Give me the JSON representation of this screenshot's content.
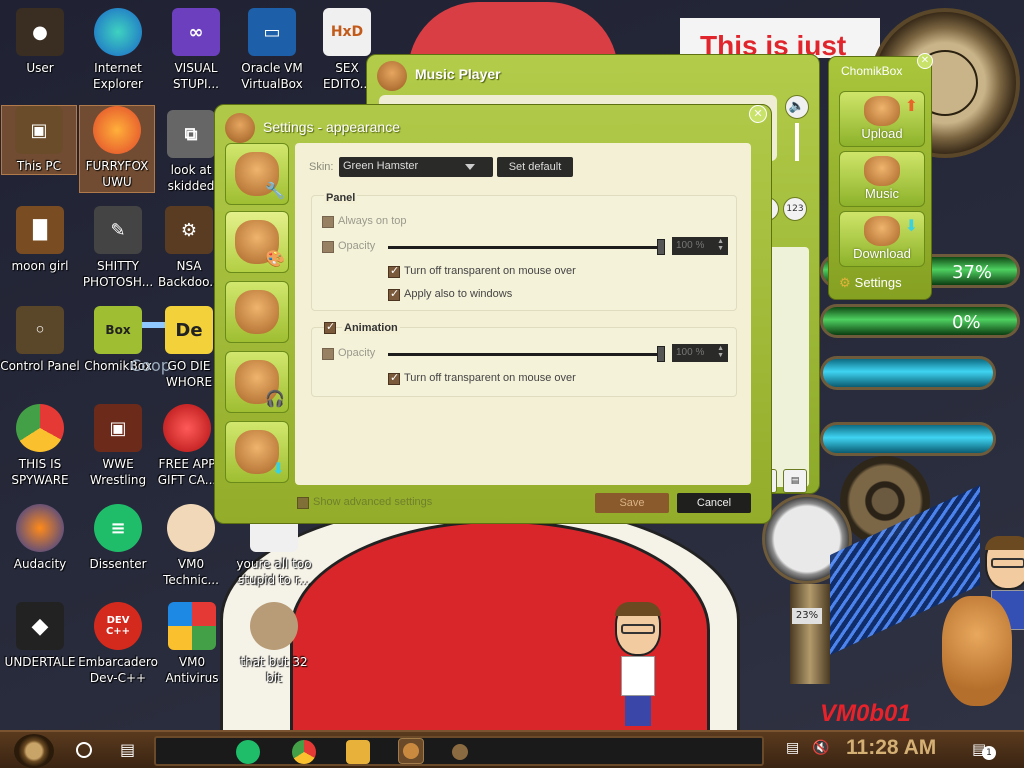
{
  "wallpaper": {
    "banner_text": "This is just",
    "signature": "VM0b01",
    "gauge_percent": "23%"
  },
  "desktop_icons": [
    {
      "id": "user",
      "label": "User",
      "icon": "user-folder-icon"
    },
    {
      "id": "ie",
      "label": "Internet Explorer",
      "icon": "edge-icon"
    },
    {
      "id": "vs",
      "label": "VISUAL STUPI...",
      "icon": "visual-studio-icon"
    },
    {
      "id": "vbox",
      "label": "Oracle VM VirtualBox",
      "icon": "virtualbox-icon"
    },
    {
      "id": "sex",
      "label": "SEX EDITO...",
      "icon": "hxd-icon"
    },
    {
      "id": "thispc",
      "label": "This PC",
      "icon": "computer-icon"
    },
    {
      "id": "furryfox",
      "label": "FURRYFOX UWU",
      "icon": "firefox-icon"
    },
    {
      "id": "skidded",
      "label": "look at skidded c...",
      "icon": "copy-icon"
    },
    {
      "id": "moongirl",
      "label": "moon girl",
      "icon": "lantern-icon"
    },
    {
      "id": "shitty",
      "label": "SHITTY PHOTOSH...",
      "icon": "gimp-icon"
    },
    {
      "id": "nsa",
      "label": "NSA Backdoo...",
      "icon": "backdoor-icon"
    },
    {
      "id": "control",
      "label": "Control Panel",
      "icon": "lightbulb-icon"
    },
    {
      "id": "chomik",
      "label": "ChomikBox",
      "icon": "chomikbox-icon"
    },
    {
      "id": "godie",
      "label": "GO DIE WHORE",
      "icon": "de-icon"
    },
    {
      "id": "spyware",
      "label": "THIS IS SPYWARE",
      "icon": "chrome-icon"
    },
    {
      "id": "wwe",
      "label": "WWE Wrestling",
      "icon": "wwe-icon"
    },
    {
      "id": "apple",
      "label": "FREE APP GIFT CA...",
      "icon": "apple-icon"
    },
    {
      "id": "audacity",
      "label": "Audacity",
      "icon": "audacity-icon"
    },
    {
      "id": "dissenter",
      "label": "Dissenter",
      "icon": "dissenter-icon"
    },
    {
      "id": "vmotech",
      "label": "VM0 Technic...",
      "icon": "technician-icon"
    },
    {
      "id": "stupid",
      "label": "youre all too stupid to r...",
      "icon": "document-icon"
    },
    {
      "id": "undertale",
      "label": "UNDERTALE",
      "icon": "unity-icon"
    },
    {
      "id": "devcpp",
      "label": "Embarcadero Dev-C++",
      "icon": "devcpp-icon"
    },
    {
      "id": "vmoav",
      "label": "VM0 Antivirus",
      "icon": "shield-icon"
    },
    {
      "id": "32bit",
      "label": "that but 32 bit",
      "icon": "portrait-icon"
    }
  ],
  "chomikbox_icon_text": "Box",
  "godie_icon_text": "De",
  "devcpp_icon_text": "DEV C++",
  "hxd_icon_text": "HxD",
  "coop_text": "Coop",
  "music_player": {
    "title": "Music Player",
    "btn_123": "123"
  },
  "chomik_panel": {
    "title": "ChomikBox",
    "buttons": [
      {
        "label": "Upload"
      },
      {
        "label": "Music"
      },
      {
        "label": "Download"
      }
    ],
    "settings_label": "Settings"
  },
  "gauges": {
    "top_percent": "37%",
    "bottom_percent": "0%"
  },
  "settings": {
    "title": "Settings - appearance",
    "skin_label": "Skin:",
    "skin_value": "Green Hamster",
    "set_default": "Set default",
    "panel_group": "Panel",
    "always_on_top": "Always on top",
    "opacity_label": "Opacity",
    "panel_opacity_value": "100 %",
    "turn_off_transparent": "Turn off transparent on mouse over",
    "apply_also": "Apply also to windows",
    "animation_group": "Animation",
    "animation_opacity_value": "100 %",
    "anim_turn_off_transparent": "Turn off transparent on mouse over",
    "show_advanced": "Show advanced settings",
    "save": "Save",
    "cancel": "Cancel"
  },
  "taskbar": {
    "time": "11:28 AM",
    "notification_count": "1"
  }
}
